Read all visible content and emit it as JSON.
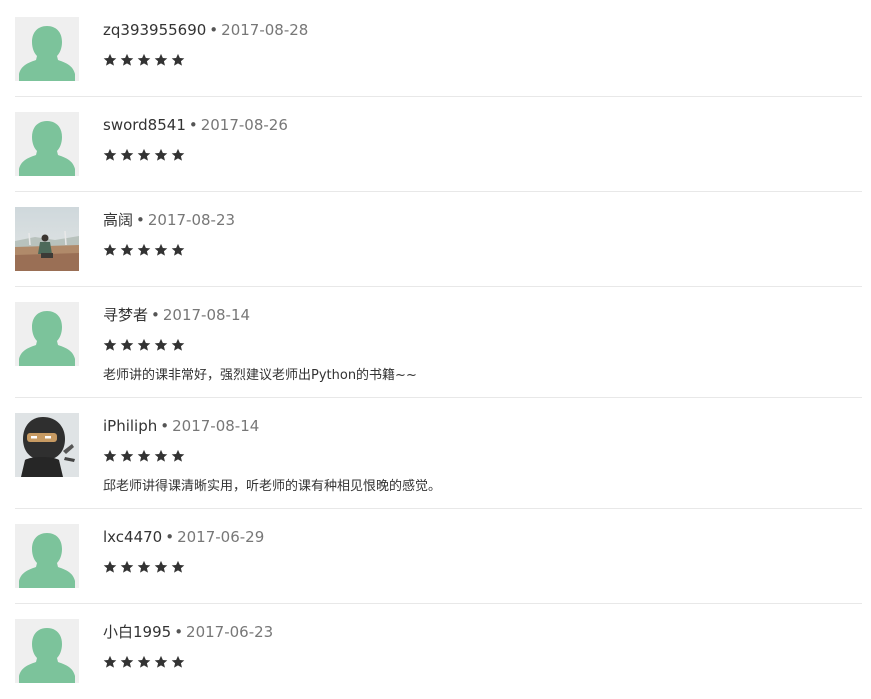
{
  "reviews": [
    {
      "username": "zq393955690",
      "separator": "•",
      "date": "2017-08-28",
      "rating": 5,
      "comment": "",
      "avatar": "default-avatar-icon"
    },
    {
      "username": "sword8541",
      "separator": "•",
      "date": "2017-08-26",
      "rating": 5,
      "comment": "",
      "avatar": "default-avatar-icon"
    },
    {
      "username": "高阔",
      "separator": "•",
      "date": "2017-08-23",
      "rating": 5,
      "comment": "",
      "avatar": "photo-avatar"
    },
    {
      "username": "寻梦者",
      "separator": "•",
      "date": "2017-08-14",
      "rating": 5,
      "comment": "老师讲的课非常好，强烈建议老师出Python的书籍~~",
      "avatar": "default-avatar-icon"
    },
    {
      "username": "iPhiliph",
      "separator": "•",
      "date": "2017-08-14",
      "rating": 5,
      "comment": "邱老师讲得课清晰实用，听老师的课有种相见恨晚的感觉。",
      "avatar": "ninja-avatar"
    },
    {
      "username": "lxc4470",
      "separator": "•",
      "date": "2017-06-29",
      "rating": 5,
      "comment": "",
      "avatar": "default-avatar-icon"
    },
    {
      "username": "小白1995",
      "separator": "•",
      "date": "2017-06-23",
      "rating": 5,
      "comment": "",
      "avatar": "default-avatar-icon"
    }
  ],
  "colors": {
    "avatar_bg": "#efefef",
    "avatar_person": "#7cc39b",
    "star": "#333333",
    "divider": "#e8e8e8",
    "date": "#777777"
  }
}
